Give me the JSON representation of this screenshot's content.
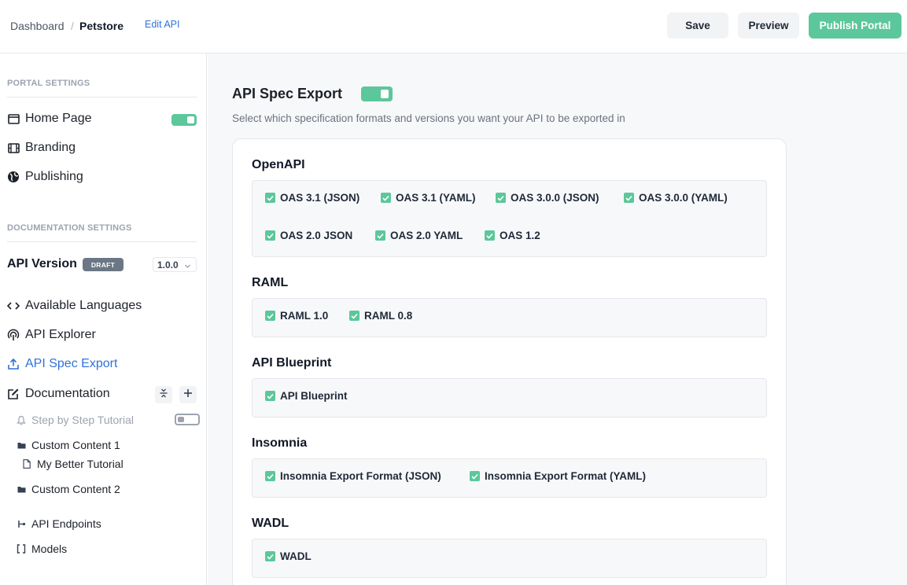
{
  "header": {
    "breadcrumb_dashboard": "Dashboard",
    "breadcrumb_separator": "/",
    "breadcrumb_current": "Petstore",
    "edit_api": "Edit API",
    "save": "Save",
    "preview": "Preview",
    "publish": "Publish Portal"
  },
  "sidebar": {
    "portal_settings_title": "PORTAL SETTINGS",
    "portal_items": [
      {
        "label": "Home Page",
        "icon": "window-icon",
        "toggle": true
      },
      {
        "label": "Branding",
        "icon": "film-icon"
      },
      {
        "label": "Publishing",
        "icon": "globe-icon"
      }
    ],
    "documentation_settings_title": "DOCUMENTATION SETTINGS",
    "api_version_label": "API Version",
    "draft_badge": "DRAFT",
    "version_value": "1.0.0",
    "doc_items": [
      {
        "label": "Available Languages",
        "icon": "code-icon"
      },
      {
        "label": "API Explorer",
        "icon": "broadcast-icon"
      },
      {
        "label": "API Spec Export",
        "icon": "upload-icon",
        "active": true
      },
      {
        "label": "Documentation",
        "icon": "edit-icon"
      }
    ],
    "doc_tree": [
      {
        "label": "Step by Step Tutorial",
        "icon": "bell-icon",
        "toggle": false
      },
      {
        "label": "Custom Content 1",
        "icon": "folder-icon"
      },
      {
        "label": "My Better Tutorial",
        "icon": "file-icon"
      },
      {
        "label": "Custom Content 2",
        "icon": "folder-icon"
      },
      {
        "label": "API Endpoints",
        "icon": "endpoint-icon"
      },
      {
        "label": "Models",
        "icon": "brackets-icon"
      }
    ]
  },
  "main": {
    "title": "API Spec Export",
    "export_enabled": true,
    "subtitle": "Select which specification formats and versions you want your API to be exported in",
    "groups": [
      {
        "title": "OpenAPI",
        "options": [
          "OAS 3.1 (JSON)",
          "OAS 3.1 (YAML)",
          "OAS 3.0.0 (JSON)",
          "OAS 3.0.0 (YAML)",
          "OAS 2.0 JSON",
          "OAS 2.0 YAML",
          "OAS 1.2"
        ]
      },
      {
        "title": "RAML",
        "options": [
          "RAML 1.0",
          "RAML 0.8"
        ]
      },
      {
        "title": "API Blueprint",
        "options": [
          "API Blueprint"
        ]
      },
      {
        "title": "Insomnia",
        "options": [
          "Insomnia Export Format (JSON)",
          "Insomnia Export Format (YAML)"
        ]
      },
      {
        "title": "WADL",
        "options": [
          "WADL"
        ]
      }
    ]
  },
  "colors": {
    "accent_green": "#5cc79a",
    "link_blue": "#2f72d8",
    "draft_badge": "#6b7785"
  }
}
